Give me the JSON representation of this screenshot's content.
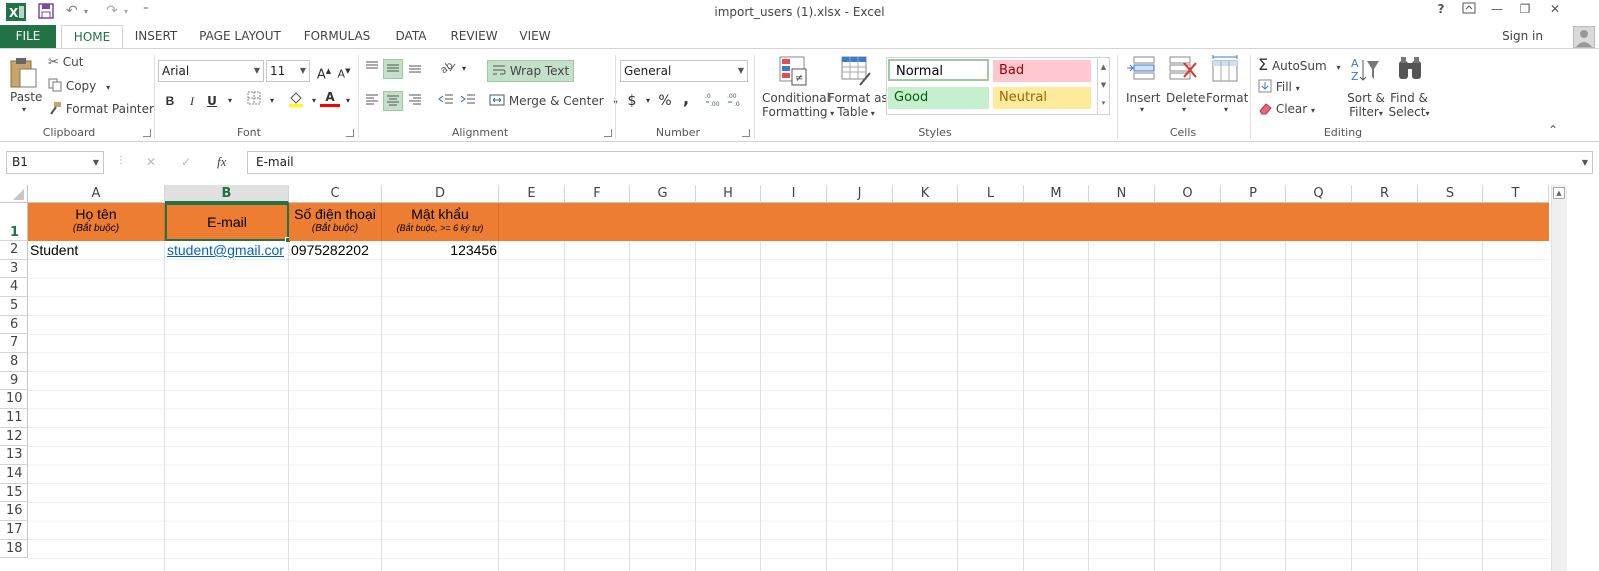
{
  "window": {
    "title": "import_users (1).xlsx - Excel",
    "help": "?",
    "minimize": "—",
    "restore": "❐",
    "close": "✕"
  },
  "qat": {
    "undo": "↶",
    "redo": "↷",
    "customize": "⁼"
  },
  "tabs": {
    "file": "FILE",
    "items": [
      "HOME",
      "INSERT",
      "PAGE LAYOUT",
      "FORMULAS",
      "DATA",
      "REVIEW",
      "VIEW"
    ],
    "signin": "Sign in"
  },
  "clipboard": {
    "paste": "Paste",
    "cut": "Cut",
    "copy": "Copy",
    "format_painter": "Format Painter",
    "label": "Clipboard"
  },
  "font": {
    "name": "Arial",
    "size": "11",
    "grow": "A",
    "shrink": "A",
    "bold": "B",
    "italic": "I",
    "underline": "U",
    "font_color_glyph": "A",
    "label": "Font"
  },
  "alignment": {
    "wrap_text": "Wrap Text",
    "merge_center": "Merge & Center",
    "label": "Alignment"
  },
  "number": {
    "format": "General",
    "currency": "$",
    "percent": "%",
    "comma": ",",
    "inc_decimal": ".0\n.00",
    "dec_decimal": ".00\n.0",
    "label": "Number"
  },
  "styles": {
    "conditional": "Conditional",
    "formatting": "Formatting",
    "format_as": "Format as",
    "table": "Table",
    "normal": "Normal",
    "bad": "Bad",
    "good": "Good",
    "neutral": "Neutral",
    "label": "Styles"
  },
  "cells": {
    "insert": "Insert",
    "delete": "Delete",
    "format": "Format",
    "label": "Cells"
  },
  "editing": {
    "autosum": "AutoSum",
    "fill": "Fill",
    "clear": "Clear",
    "sort": "Sort &",
    "filter": "Filter",
    "find": "Find &",
    "select": "Select",
    "label": "Editing"
  },
  "formula_bar": {
    "name_box": "B1",
    "cancel": "✕",
    "enter": "✓",
    "fx": "fx",
    "content": "E-mail"
  },
  "sheet": {
    "columns": [
      "A",
      "B",
      "C",
      "D",
      "E",
      "F",
      "G",
      "H",
      "I",
      "J",
      "K",
      "L",
      "M",
      "N",
      "O",
      "P",
      "Q",
      "R",
      "S",
      "T"
    ],
    "rows": [
      "1",
      "2",
      "3",
      "4",
      "5",
      "6",
      "7",
      "8",
      "9",
      "10",
      "11",
      "12",
      "13",
      "14",
      "15",
      "16",
      "17",
      "18"
    ],
    "selected_column": "B",
    "selected_row": "1",
    "header": {
      "a_main": "Họ tên",
      "a_sub": "(Bắt buộc)",
      "b_main": "E-mail",
      "c_main": "Số điện thoại",
      "c_sub": "(Bắt buộc)",
      "d_main": "Mật khẩu",
      "d_sub": "(Bắt buộc, >= 6 ký tự)",
      "fill_color": "#ed7d31"
    },
    "row2": {
      "a": "Student",
      "b": "student@gmail.cor",
      "c": "0975282202",
      "d": "123456"
    }
  },
  "colors": {
    "excel_green": "#217346",
    "good_bg": "#c6efce",
    "bad_bg": "#ffc7ce",
    "neutral_bg": "#ffeb9c"
  }
}
